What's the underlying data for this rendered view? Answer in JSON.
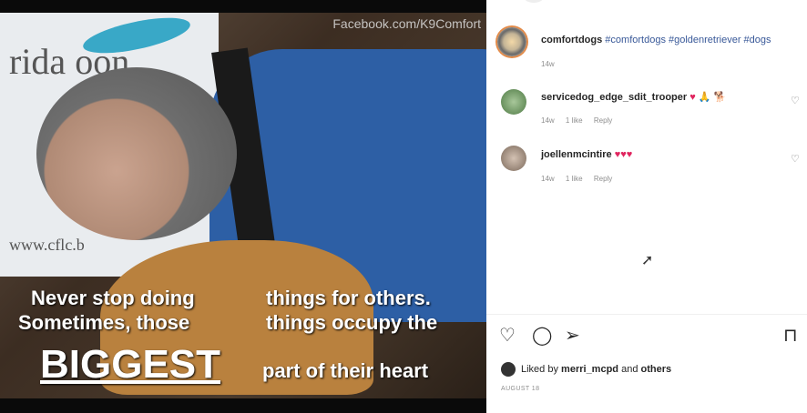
{
  "image": {
    "watermark": "Facebook.com/K9Comfort",
    "banner_text": "rida    oon",
    "banner_url": "www.cflc.b",
    "caption": {
      "line1a": "Never stop doing",
      "line1b": "things for others.",
      "line2a": "Sometimes, those",
      "line2b": "things occupy the",
      "big": "BIGGEST",
      "line3": "part of their heart"
    }
  },
  "post": {
    "author": "comfortdogs",
    "hashtags": "#comfortdogs #goldenretriever #dogs",
    "time": "14w"
  },
  "comments": [
    {
      "username": "servicedog_edge_sdit_trooper",
      "text": "♥ 🙏 🐕",
      "time": "14w",
      "likes": "1 like",
      "reply": "Reply"
    },
    {
      "username": "joellenmcintire",
      "text": "♥♥♥",
      "time": "14w",
      "likes": "1 like",
      "reply": "Reply"
    }
  ],
  "actions": {
    "like_icon": "heart-outline",
    "comment_icon": "comment-bubble",
    "share_icon": "paper-plane",
    "save_icon": "bookmark"
  },
  "likes": {
    "prefix": "Liked by",
    "user": "merri_mcpd",
    "and": "and",
    "others": "others"
  },
  "date": "AUGUST 18"
}
